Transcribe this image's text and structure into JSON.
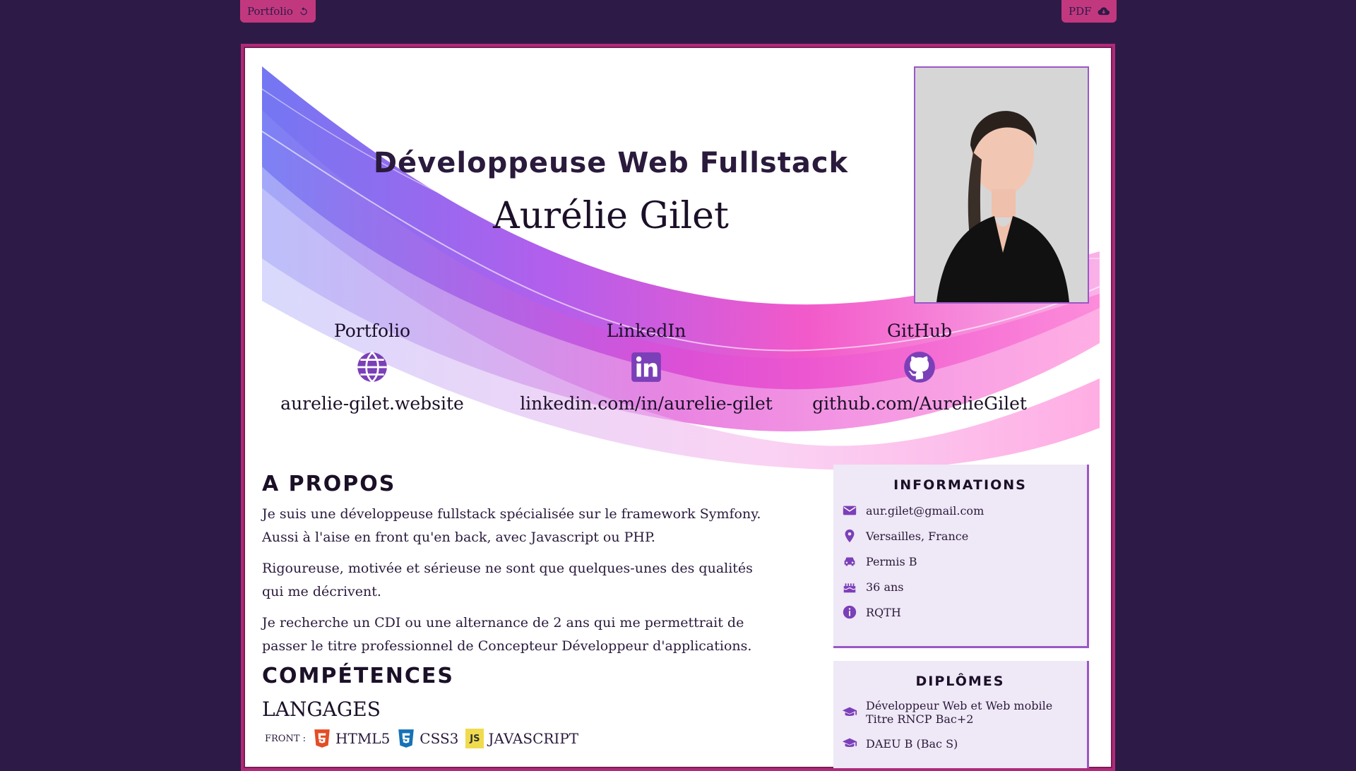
{
  "topbar": {
    "portfolio_label": "Portfolio",
    "pdf_label": "PDF"
  },
  "header": {
    "subtitle": "Développeuse Web Fullstack",
    "name": "Aurélie Gilet"
  },
  "contacts": [
    {
      "label": "Portfolio",
      "value": "aurelie-gilet.website",
      "icon": "globe-icon"
    },
    {
      "label": "LinkedIn",
      "value": "linkedin.com/in/aurelie-gilet",
      "icon": "linkedin-icon"
    },
    {
      "label": "GitHub",
      "value": "github.com/AurelieGilet",
      "icon": "github-icon"
    }
  ],
  "about": {
    "title": "A PROPOS",
    "paragraphs": [
      "Je suis une développeuse fullstack spécialisée sur le framework Symfony. Aussi à l'aise en front qu'en back, avec Javascript ou PHP.",
      "Rigoureuse, motivée et sérieuse ne sont que quelques-unes des qualités qui me décrivent.",
      "Je recherche un CDI ou une alternance de 2 ans qui me permettrait de passer le titre professionnel de Concepteur Développeur d'applications."
    ]
  },
  "skills": {
    "title": "COMPÉTENCES",
    "languages_title": "LANGAGES",
    "front_label": "FRONT :",
    "front": [
      "HTML5",
      "CSS3",
      "JAVASCRIPT"
    ]
  },
  "informations": {
    "title": "INFORMATIONS",
    "items": [
      {
        "icon": "envelope-icon",
        "text": "aur.gilet@gmail.com"
      },
      {
        "icon": "map-pin-icon",
        "text": "Versailles, France"
      },
      {
        "icon": "car-icon",
        "text": "Permis B"
      },
      {
        "icon": "birthday-cake-icon",
        "text": "36 ans"
      },
      {
        "icon": "info-icon",
        "text": "RQTH"
      }
    ]
  },
  "diplomas": {
    "title": "DIPLÔMES",
    "items": [
      {
        "icon": "graduation-cap-icon",
        "line1": "Développeur Web et Web mobile",
        "line2": "Titre RNCP Bac+2"
      },
      {
        "icon": "graduation-cap-icon",
        "line1": "DAEU B (Bac S)",
        "line2": ""
      }
    ]
  },
  "colors": {
    "background": "#2e1a47",
    "accent": "#c2387f",
    "purple": "#7b3fb8",
    "card": "#efe8f6"
  }
}
